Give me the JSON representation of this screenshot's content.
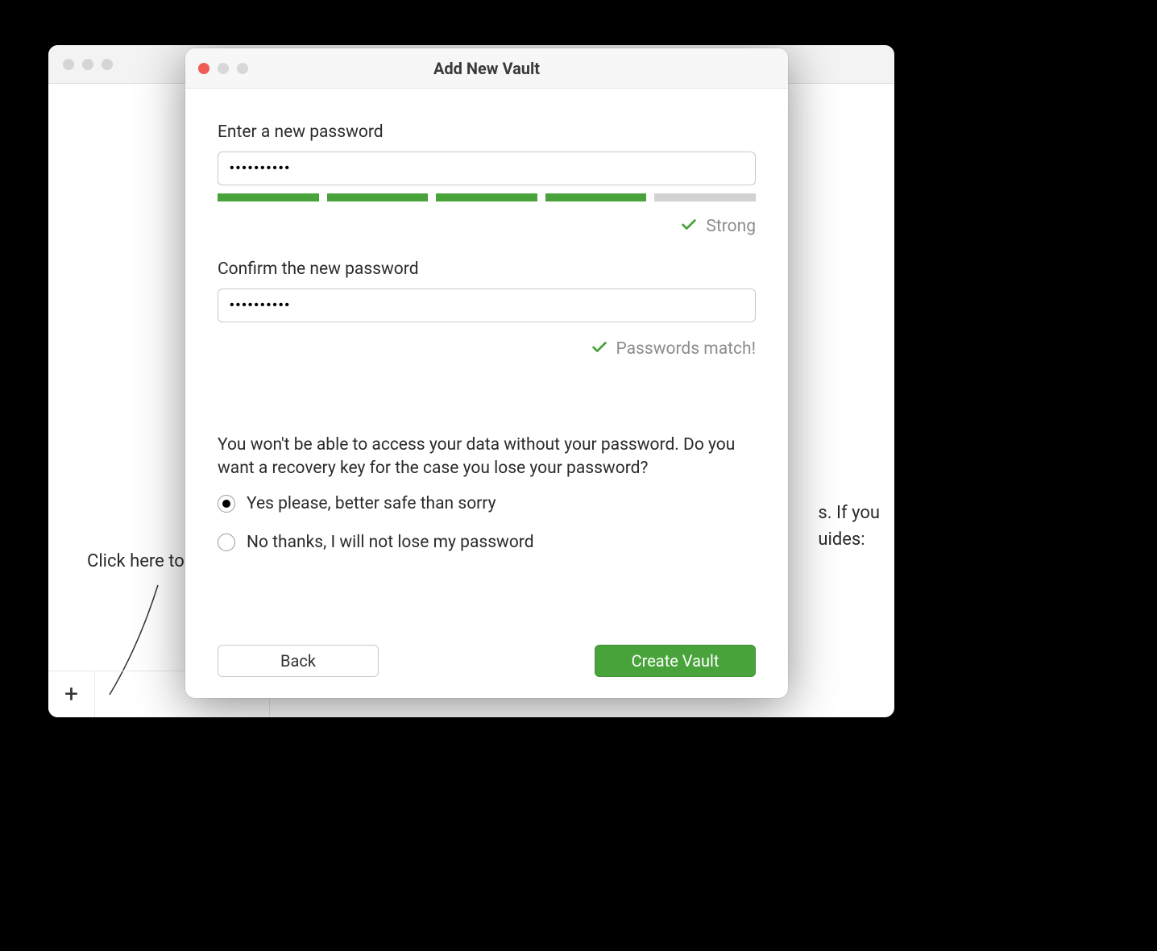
{
  "main_window": {
    "sidebar": {
      "hint_text": "Click here to",
      "add_button_label": "+"
    },
    "content_peek_line1": "s. If you",
    "content_peek_line2": "uides:"
  },
  "modal": {
    "title": "Add New Vault",
    "password_label": "Enter a new password",
    "password_value": "••••••••••",
    "strength_label": "Strong",
    "strength_segments_filled": 4,
    "confirm_label": "Confirm the new password",
    "confirm_value": "••••••••••",
    "match_label": "Passwords match!",
    "recovery_prompt": "You won't be able to access your data without your password. Do you want a recovery key for the case you lose your password?",
    "radio_yes": "Yes please, better safe than sorry",
    "radio_no": "No thanks, I will not lose my password",
    "radio_selected": "yes",
    "back_button": "Back",
    "create_button": "Create Vault"
  }
}
